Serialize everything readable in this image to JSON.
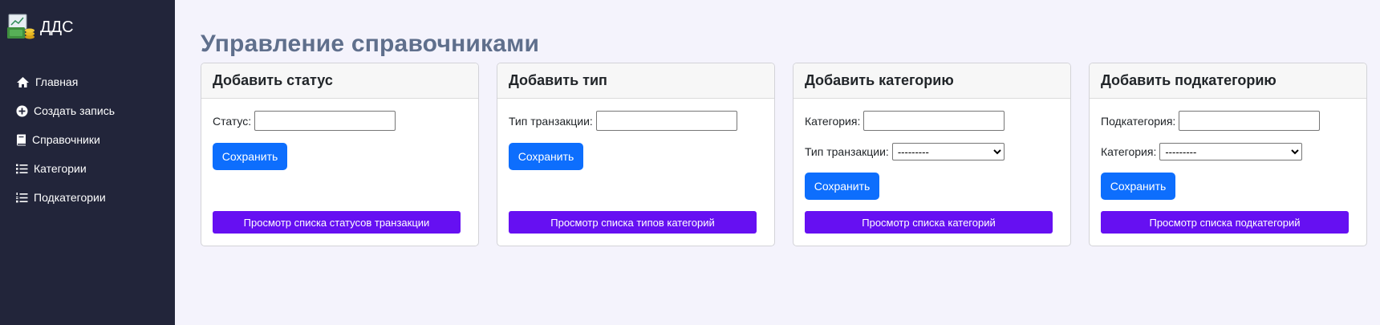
{
  "brand": {
    "title": "ДДС"
  },
  "nav": {
    "items": [
      {
        "label": "Главная",
        "icon": "home-icon"
      },
      {
        "label": "Создать запись",
        "icon": "plus-circle-icon"
      },
      {
        "label": "Справочники",
        "icon": "book-icon"
      },
      {
        "label": "Категории",
        "icon": "list-icon"
      },
      {
        "label": "Подкатегории",
        "icon": "list-ordered-icon"
      }
    ]
  },
  "page": {
    "title": "Управление справочниками"
  },
  "cards": [
    {
      "title": "Добавить статус",
      "fields": [
        {
          "label": "Статус:",
          "value": ""
        }
      ],
      "save_label": "Сохранить",
      "list_label": "Просмотр списка статусов транзакции"
    },
    {
      "title": "Добавить тип",
      "fields": [
        {
          "label": "Тип транзакции:",
          "value": ""
        }
      ],
      "save_label": "Сохранить",
      "list_label": "Просмотр списка типов категорий"
    },
    {
      "title": "Добавить категорию",
      "fields": [
        {
          "label": "Категория:",
          "value": ""
        },
        {
          "label": "Тип транзакции:",
          "selected": "---------"
        }
      ],
      "save_label": "Сохранить",
      "list_label": "Просмотр списка категорий"
    },
    {
      "title": "Добавить подкатегорию",
      "fields": [
        {
          "label": "Подкатегория:",
          "value": ""
        },
        {
          "label": "Категория:",
          "selected": "---------"
        }
      ],
      "save_label": "Сохранить",
      "list_label": "Просмотр списка подкатегорий"
    }
  ],
  "colors": {
    "sidebar_bg": "#22253a",
    "page_bg": "#f4f3fc",
    "primary": "#0d6efd",
    "purple": "#6610f2",
    "title": "#5f6f8c"
  }
}
